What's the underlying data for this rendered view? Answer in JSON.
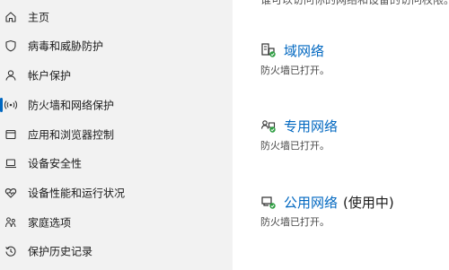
{
  "sidebar": {
    "items": [
      {
        "label": "主页",
        "icon": "home-icon"
      },
      {
        "label": "病毒和威胁防护",
        "icon": "shield-icon"
      },
      {
        "label": "帐户保护",
        "icon": "person-icon"
      },
      {
        "label": "防火墙和网络保护",
        "icon": "wifi-antenna-icon",
        "active": true
      },
      {
        "label": "应用和浏览器控制",
        "icon": "app-window-icon"
      },
      {
        "label": "设备安全性",
        "icon": "laptop-icon"
      },
      {
        "label": "设备性能和运行状况",
        "icon": "heart-pulse-icon"
      },
      {
        "label": "家庭选项",
        "icon": "family-icon"
      },
      {
        "label": "保护历史记录",
        "icon": "history-icon"
      }
    ],
    "accent": "#0067c0"
  },
  "main": {
    "truncated_description": "谁可以访问你的网络和设备的访问权限。",
    "networks": [
      {
        "name": "域网络",
        "status": "防火墙已打开。",
        "icon": "domain-network-icon",
        "in_use": ""
      },
      {
        "name": "专用网络",
        "status": "防火墙已打开。",
        "icon": "private-network-icon",
        "in_use": ""
      },
      {
        "name": "公用网络",
        "status": "防火墙已打开。",
        "icon": "public-network-icon",
        "in_use": "(使用中)"
      }
    ]
  }
}
